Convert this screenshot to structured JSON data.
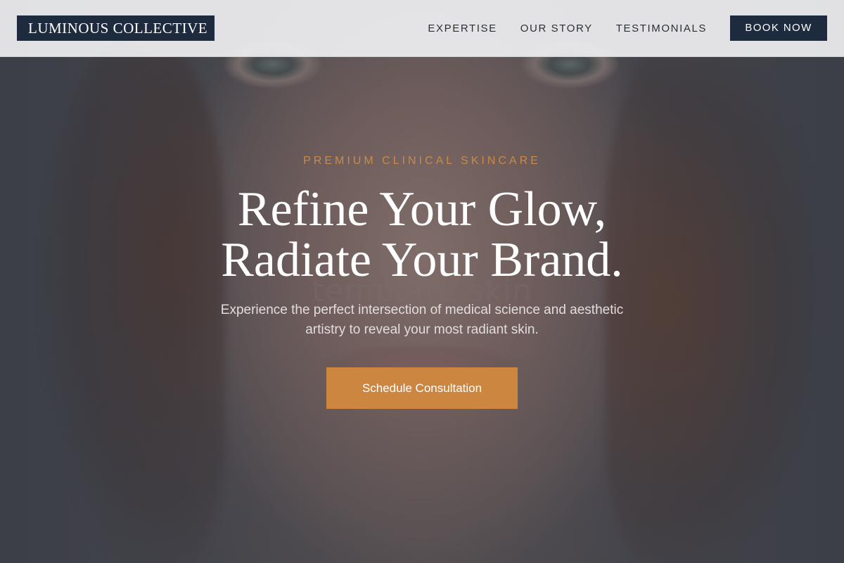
{
  "header": {
    "logo_text": "LUMINOUS COLLECTIVE",
    "nav": [
      {
        "label": "EXPERTISE"
      },
      {
        "label": "OUR STORY"
      },
      {
        "label": "TESTIMONIALS"
      }
    ],
    "cta_label": "BOOK NOW"
  },
  "hero": {
    "eyebrow": "PREMIUM CLINICAL SKINCARE",
    "headline_line1": "Refine Your Glow,",
    "headline_line2": "Radiate Your Brand.",
    "subtext_line1": "Experience the perfect intersection of medical science and aesthetic",
    "subtext_line2": "artistry to reveal your most radiant skin.",
    "cta_label": "Schedule Consultation",
    "watermark": "template.skin"
  },
  "colors": {
    "navy": "#1e2a3e",
    "accent": "#cd8640",
    "eyebrow": "#c98a48",
    "header_bg": "#ececee"
  }
}
